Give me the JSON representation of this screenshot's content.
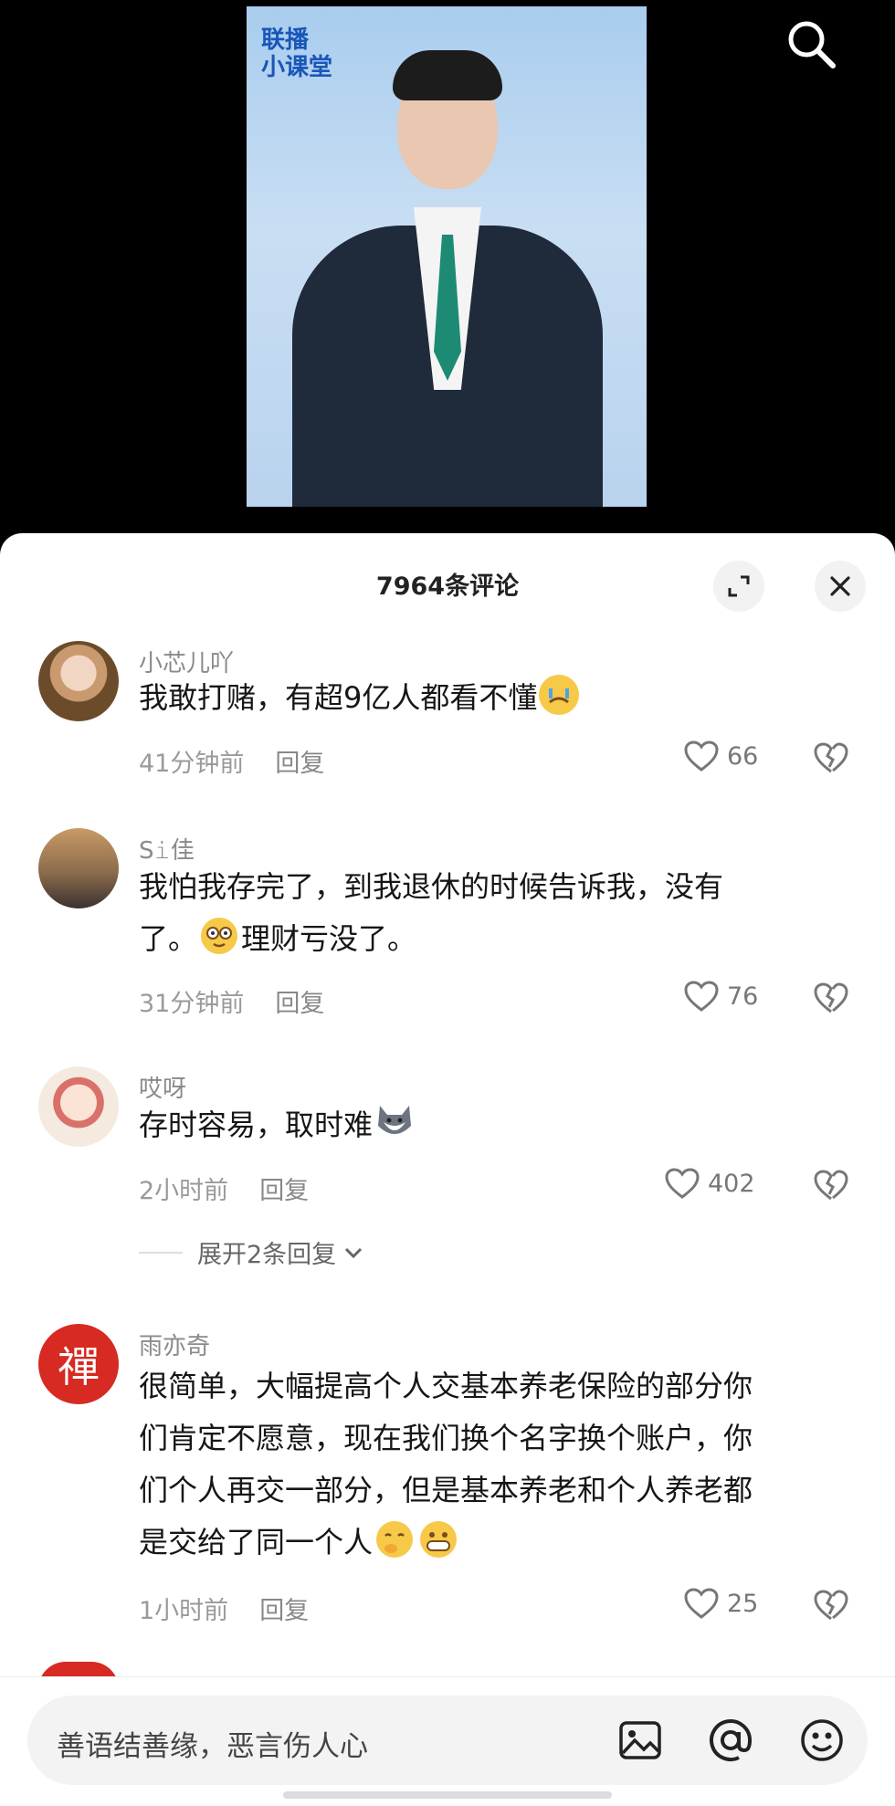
{
  "video": {
    "logo_line1": "联播",
    "logo_line2": "小课堂"
  },
  "panel": {
    "title": "7964条评论"
  },
  "comments": [
    {
      "username": "小芯儿吖",
      "text": "我敢打赌，有超9亿人都看不懂",
      "time": "41分钟前",
      "reply": "回复",
      "likes": "66"
    },
    {
      "username": "S𝚒佳",
      "text1": "我怕我存完了，到我退休的时候告诉我，没有",
      "text2": "了。",
      "text3": "理财亏没了。",
      "time": "31分钟前",
      "reply": "回复",
      "likes": "76"
    },
    {
      "username": "哎呀",
      "text": "存时容易，取时难",
      "time": "2小时前",
      "reply": "回复",
      "likes": "402",
      "expand": "展开2条回复"
    },
    {
      "username": "雨亦奇",
      "avatar_char": "禪",
      "lines": [
        "很简单，大幅提高个人交基本养老保险的部分你",
        "们肯定不愿意，现在我们换个名字换个账户，你",
        "们个人再交一部分，但是基本养老和个人养老都",
        "是交给了同一个人"
      ],
      "time": "1小时前",
      "reply": "回复",
      "likes": "25"
    }
  ],
  "input": {
    "placeholder": "善语结善缘，恶言伤人心"
  },
  "colors": {
    "accent_red": "#d62a22",
    "tie_green": "#1d8a74"
  }
}
